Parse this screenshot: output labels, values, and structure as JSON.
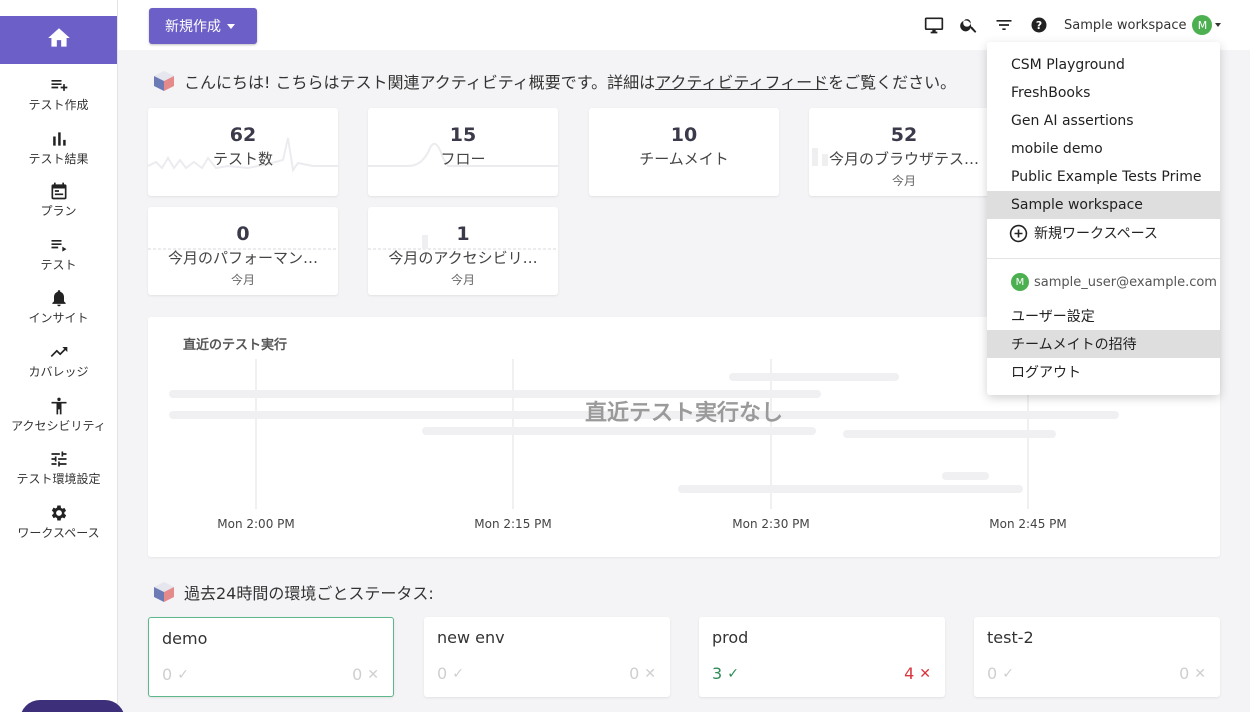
{
  "sidebar": {
    "home_icon": "home-icon",
    "items": [
      {
        "label": "テスト作成",
        "icon": "playlist-add-icon"
      },
      {
        "label": "テスト結果",
        "icon": "bar-chart-icon"
      },
      {
        "label": "プラン",
        "icon": "calendar-icon"
      },
      {
        "label": "テスト",
        "icon": "playlist-play-icon"
      },
      {
        "label": "インサイト",
        "icon": "bell-icon"
      },
      {
        "label": "カバレッジ",
        "icon": "trending-up-icon"
      },
      {
        "label": "アクセシビリティ",
        "icon": "accessibility-icon"
      },
      {
        "label": "テスト環境設定",
        "icon": "tune-icon"
      },
      {
        "label": "ワークスペース",
        "icon": "gear-icon"
      }
    ]
  },
  "topbar": {
    "new_button": "新規作成",
    "workspace_label": "Sample workspace",
    "avatar_letter": "M",
    "icons": [
      "monitor-icon",
      "search-icon",
      "filter-icon",
      "help-icon"
    ]
  },
  "greeting": {
    "prefix": "こんにちは! こちらはテスト関連アクティビティ概要です。詳細は",
    "link": "アクティビティフィード",
    "suffix": "をご覧ください。"
  },
  "stats": [
    {
      "value": "62",
      "label": "テスト数",
      "sub": ""
    },
    {
      "value": "15",
      "label": "フロー",
      "sub": ""
    },
    {
      "value": "10",
      "label": "チームメイト",
      "sub": ""
    },
    {
      "value": "52",
      "label": "今月のブラウザテス…",
      "sub": "今月"
    },
    {
      "value": "0",
      "label": "今月のパフォーマン…",
      "sub": "今月"
    },
    {
      "value": "1",
      "label": "今月のアクセシビリ…",
      "sub": "今月"
    }
  ],
  "recent_runs": {
    "title": "直近のテスト実行",
    "empty_message": "直近テスト実行なし",
    "x_ticks": [
      "Mon 2:00 PM",
      "Mon 2:15 PM",
      "Mon 2:30 PM",
      "Mon 2:45 PM"
    ]
  },
  "env_section": {
    "title": "過去24時間の環境ごとステータス:",
    "envs": [
      {
        "name": "demo",
        "passed": "0",
        "failed": "0",
        "selected": true
      },
      {
        "name": "new env",
        "passed": "0",
        "failed": "0",
        "selected": false
      },
      {
        "name": "prod",
        "passed": "3",
        "failed": "4",
        "selected": false
      },
      {
        "name": "test-2",
        "passed": "0",
        "failed": "0",
        "selected": false
      }
    ]
  },
  "dropdown": {
    "workspaces": [
      "CSM Playground",
      "FreshBooks",
      "Gen AI assertions",
      "mobile demo",
      "Public Example Tests Prime",
      "Sample workspace"
    ],
    "current_workspace": "Sample workspace",
    "new_workspace": "新規ワークスペース",
    "user_email": "sample_user@example.com",
    "user_settings": "ユーザー設定",
    "invite": "チームメイトの招待",
    "logout": "ログアウト"
  },
  "colors": {
    "accent": "#6c5fc7",
    "pass": "#2e8b57",
    "fail": "#d9363e",
    "avatar": "#4caf50"
  }
}
